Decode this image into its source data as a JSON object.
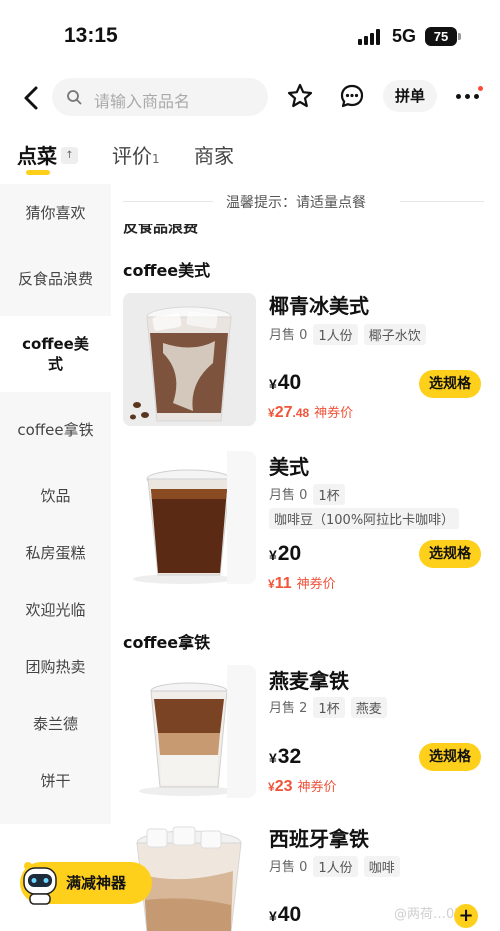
{
  "status_bar": {
    "time": "13:15",
    "network": "5G",
    "battery": "75"
  },
  "header": {
    "search_placeholder": "请输入商品名",
    "group_order": "拼单"
  },
  "tabs": [
    {
      "label": "点菜",
      "badge": ""
    },
    {
      "label": "评价",
      "count": "1"
    },
    {
      "label": "商家"
    }
  ],
  "sidebar": {
    "items": [
      "猜你喜欢",
      "反食品浪费",
      "coffee美式",
      "coffee拿铁",
      "饮品",
      "私房蛋糕",
      "欢迎光临",
      "团购热卖",
      "泰兰德",
      "饼干"
    ],
    "active": "coffee美式"
  },
  "notice": "温馨提示：请适量点餐",
  "cut_heading": "反食品浪费",
  "categories": {
    "americano": "coffee美式",
    "latte": "coffee拿铁"
  },
  "products": [
    {
      "name": "椰青冰美式",
      "sold": "月售 0",
      "tags": [
        "1人份",
        "椰子水饮"
      ],
      "currency": "¥",
      "price": "40",
      "promo_price_int": "27",
      "promo_price_dec": ".48",
      "promo_label": "神券价",
      "button": "选规格"
    },
    {
      "name": "美式",
      "sold": "月售 0",
      "tags": [
        "1杯"
      ],
      "tag_line2": "咖啡豆（100%阿拉比卡咖啡）",
      "currency": "¥",
      "price": "20",
      "promo_price_int": "11",
      "promo_price_dec": "",
      "promo_label": "神券价",
      "button": "选规格"
    },
    {
      "name": "燕麦拿铁",
      "sold": "月售 2",
      "tags": [
        "1杯",
        "燕麦"
      ],
      "currency": "¥",
      "price": "32",
      "promo_price_int": "23",
      "promo_price_dec": "",
      "promo_label": "神券价",
      "button": "选规格"
    },
    {
      "name": "西班牙拿铁",
      "sold": "月售 0",
      "tags": [
        "1人份",
        "咖啡"
      ],
      "currency": "¥",
      "price": "40"
    }
  ],
  "floating": {
    "label": "满减神器",
    "plus": "+"
  },
  "watermark": "@两荷…02",
  "colors": {
    "accent": "#ffd01b",
    "promo": "#f0543a",
    "sidebar_bg": "#f7f7f7"
  },
  "icons": [
    "back-icon",
    "search-icon",
    "star-icon",
    "chat-icon",
    "more-icon",
    "robot-icon"
  ]
}
